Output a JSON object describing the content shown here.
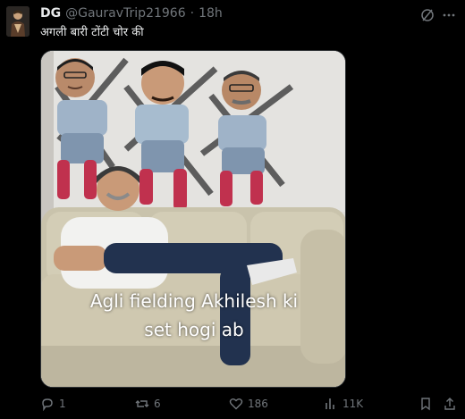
{
  "tweet": {
    "display_name": "DG",
    "handle": "@GauravTrip21966",
    "separator": "·",
    "time": "18h",
    "text": "अगली बारी टोंटी चोर की"
  },
  "media": {
    "caption_line1": "Agli fielding Akhilesh ki",
    "caption_line2": "set hogi ab"
  },
  "actions": {
    "reply_count": "1",
    "retweet_count": "6",
    "like_count": "186",
    "views_count": "11K"
  },
  "icons": {
    "grok": "grok-icon",
    "more": "more-options-icon",
    "reply": "reply-icon",
    "retweet": "retweet-icon",
    "like": "heart-icon",
    "views": "views-icon",
    "bookmark": "bookmark-icon",
    "share": "share-icon"
  },
  "colors": {
    "background": "#000000",
    "text": "#e7e9ea",
    "muted": "#71767b"
  }
}
